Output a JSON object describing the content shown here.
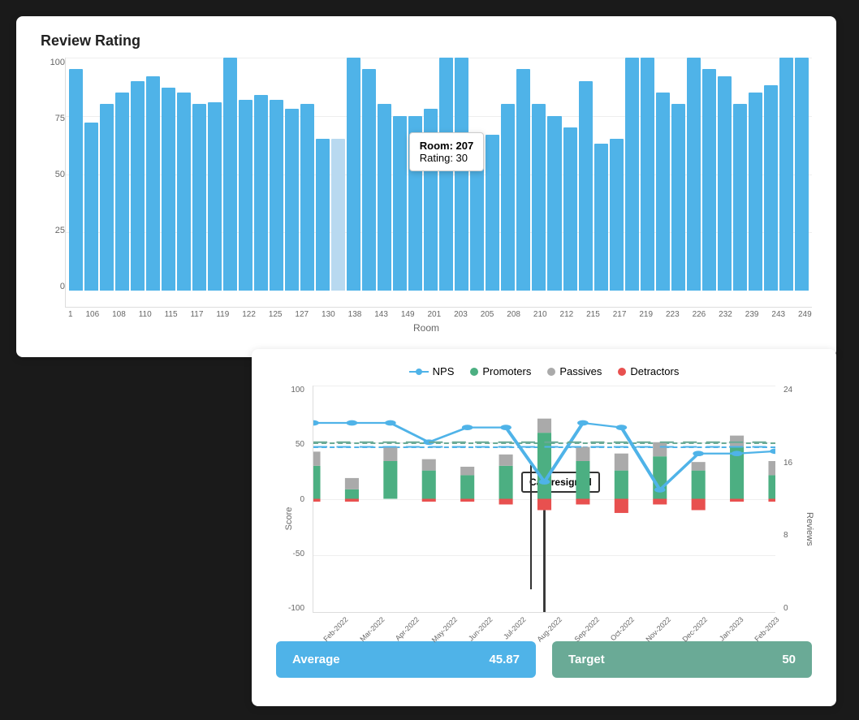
{
  "topChart": {
    "title": "Review Rating",
    "yLabels": [
      "100",
      "75",
      "50",
      "25",
      "0"
    ],
    "xAxisTitle": "Room",
    "xLabels": [
      "1",
      "106",
      "108",
      "110",
      "115",
      "117",
      "119",
      "122",
      "125",
      "127",
      "130",
      "138",
      "143",
      "149",
      "201",
      "203",
      "205",
      "208",
      "210",
      "212",
      "215",
      "217",
      "219",
      "223",
      "226",
      "232",
      "239",
      "243",
      "249"
    ],
    "tooltip": {
      "line1": "Room: 207",
      "line2": "Rating: 30"
    },
    "bars": [
      95,
      72,
      80,
      85,
      90,
      92,
      87,
      85,
      80,
      81,
      100,
      82,
      84,
      82,
      78,
      80,
      65,
      65,
      100,
      95,
      80,
      75,
      75,
      78,
      100,
      100,
      62,
      67,
      80,
      95,
      80,
      75,
      70,
      90,
      63,
      65,
      100,
      100,
      85,
      80,
      100,
      95,
      92,
      80,
      85,
      88,
      100,
      100
    ]
  },
  "bottomChart": {
    "legend": {
      "nps": "NPS",
      "promoters": "Promoters",
      "passives": "Passives",
      "detractors": "Detractors"
    },
    "yLabels": [
      "100",
      "50",
      "0",
      "-50",
      "-100"
    ],
    "y2Labels": [
      "24",
      "16",
      "8",
      "0"
    ],
    "yAxisTitle": "Score",
    "y2AxisTitle": "Reviews",
    "xLabels": [
      "Feb-2022",
      "Mar-2022",
      "Apr-2022",
      "May-2022",
      "Jun-2022",
      "Jul-2022",
      "Aug-2022",
      "Sep-2022",
      "Oct-2022",
      "Nov-2022",
      "Dec-2022",
      "Jan-2023",
      "Feb-2023"
    ],
    "annotation": "Carl resigned",
    "averageLabel": "Average",
    "averageValue": "45.87",
    "targetLabel": "Target",
    "targetValue": "50",
    "dashedLineAvg": 45.87,
    "dashedLineTarget": 50
  }
}
